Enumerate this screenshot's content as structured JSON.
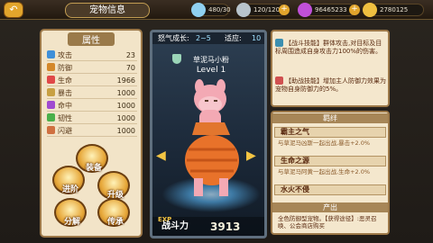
{
  "header": {
    "title": "宠物信息"
  },
  "resources": [
    {
      "icon": "diamond-icon",
      "value": "480/30"
    },
    {
      "icon": "energy-icon",
      "value": "120/120"
    },
    {
      "icon": "gem-icon",
      "value": "96465233"
    },
    {
      "icon": "coin-icon",
      "value": "2780125"
    }
  ],
  "attributes": {
    "title": "属性",
    "rows": [
      {
        "label": "攻击",
        "value": "23",
        "color": "#3f8fd8"
      },
      {
        "label": "防御",
        "value": "70",
        "color": "#d4882a"
      },
      {
        "label": "生命",
        "value": "1966",
        "color": "#e04848"
      },
      {
        "label": "暴击",
        "value": "1000",
        "color": "#c8a042"
      },
      {
        "label": "命中",
        "value": "1000",
        "color": "#a04ad0"
      },
      {
        "label": "韧性",
        "value": "1000",
        "color": "#4ab04a"
      },
      {
        "label": "闪避",
        "value": "1000",
        "color": "#d07040"
      }
    ]
  },
  "buttons": {
    "equip": "装备",
    "advance": "进阶",
    "upgrade": "升级",
    "decompose": "分解",
    "inherit": "传承"
  },
  "pet": {
    "rage_label": "怒气成长:",
    "rage_value": "2~5",
    "fit_label": "适应:",
    "fit_value": "10",
    "name": "草泥马小粉",
    "level": "Level 1",
    "exp_label": "EXP",
    "power_label": "战斗力",
    "power_value": "3913"
  },
  "skills": [
    {
      "tag": "【战斗技能】",
      "text": "群体攻击,对目标及目标周围造成自身攻击力100%的伤害。"
    },
    {
      "tag": "【助战技能】",
      "text": "增加主人防御力效果为宠物自身防御力的5%。"
    }
  ],
  "bond": {
    "title": "羁绊",
    "items": [
      {
        "name": "霸主之气",
        "desc": "与草泥马凶斯一起出战,暴击+2.0%"
      },
      {
        "name": "生命之源",
        "desc": "与草泥马阿黄一起出战,生命+2.0%"
      },
      {
        "name": "水火不侵",
        "desc": ""
      }
    ]
  },
  "produce": {
    "title": "产出",
    "text": "全色防御型宠物。【获得途径】:恶灵召唤、公会商店购买"
  }
}
